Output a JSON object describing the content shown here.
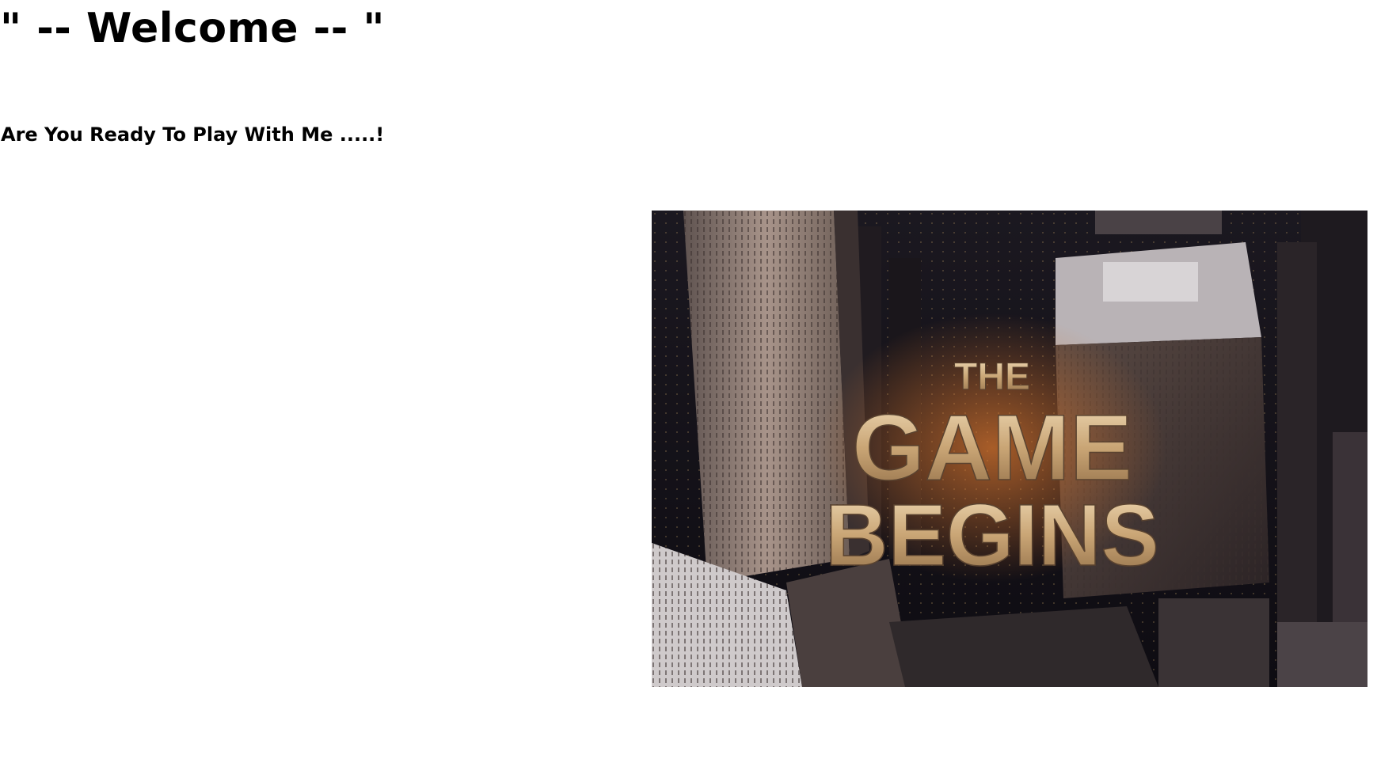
{
  "header": {
    "title": "\" -- Welcome -- \"",
    "subtitle": "Are You Ready To Play With Me .....!"
  },
  "poster": {
    "line1": "THE",
    "line2": "GAME",
    "line3": "BEGINS",
    "colors": {
      "sky": "#14121a",
      "building_light": "#8b7a70",
      "building_dark": "#2a2426",
      "text_gold": "#d9b98a",
      "glow": "#c06a2a"
    }
  }
}
